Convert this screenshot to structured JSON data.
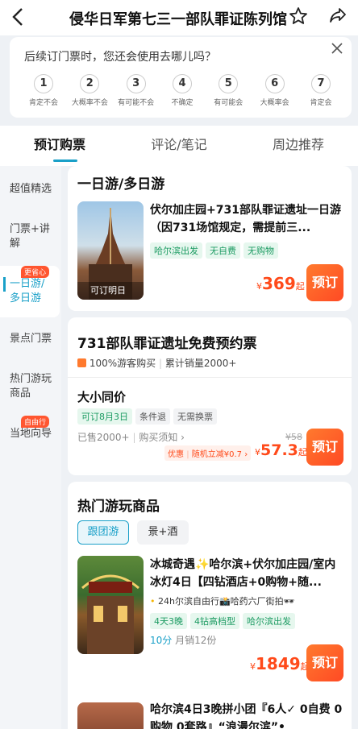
{
  "header": {
    "title": "侵华日军第七三一部队罪证陈列馆",
    "back_icon": "back-arrow-icon",
    "star_icon": "star-icon",
    "share_icon": "share-icon"
  },
  "survey": {
    "question": "后续订门票时，您还会使用去哪儿吗？",
    "options": [
      {
        "num": "1",
        "label": "肯定不会"
      },
      {
        "num": "2",
        "label": "大概率不会"
      },
      {
        "num": "3",
        "label": "有可能不会"
      },
      {
        "num": "4",
        "label": "不确定"
      },
      {
        "num": "5",
        "label": "有可能会"
      },
      {
        "num": "6",
        "label": "大概率会"
      },
      {
        "num": "7",
        "label": "肯定会"
      }
    ]
  },
  "tabs": [
    "预订购票",
    "评论/笔记",
    "周边推荐"
  ],
  "sidebar": {
    "items": [
      "超值精选",
      "门票+讲解",
      "一日游/多日游",
      "景点门票",
      "热门游玩商品",
      "当地向导"
    ],
    "badge_active": "更省心",
    "badge_guide": "自由行"
  },
  "section1": {
    "title": "一日游/多日游",
    "product": {
      "name": "伏尔加庄园+731部队罪证遗址一日游（因731场馆规定，需提前三...",
      "tags": [
        "哈尔滨出发",
        "无自费",
        "无购物"
      ],
      "image_caption": "可订明日",
      "price_symbol": "¥",
      "price": "369",
      "price_suffix": "起",
      "book": "预订"
    }
  },
  "section2": {
    "title": "731部队罪证遗址免费预约票",
    "rating": "100%游客购买",
    "sales": "累计销量2000+",
    "ticket": {
      "name": "大小同价",
      "tags": [
        "可订8月3日",
        "条件退",
        "无需换票"
      ],
      "sold": "已售2000+",
      "notice": "购买须知 ›",
      "discount_label": "优惠",
      "discount_text": "随机立减¥0.7 ›",
      "orig_price": "¥58",
      "price_symbol": "¥",
      "price": "57.3",
      "price_suffix": "起",
      "book": "预订"
    }
  },
  "section3": {
    "title": "热门游玩商品",
    "chips": [
      "跟团游",
      "景+酒"
    ],
    "product": {
      "name": "冰城奇遇✨哈尔滨+伏尔加庄园/室内冰灯4日【四钻酒店+0购物+随...",
      "feature": "24h尔滨自由行📸哈药六厂街拍🕶",
      "tags": [
        "4天3晚",
        "4钻高档型",
        "哈尔滨出发"
      ],
      "rating": "10分",
      "sales": "月销12份",
      "price_symbol": "¥",
      "price": "1849",
      "price_suffix": "起",
      "book": "预订"
    },
    "next_product": "哈尔滨4日3晚拼小团『6人✓ 0自费 0购物 0套路』“浪漫尔滨”•"
  }
}
